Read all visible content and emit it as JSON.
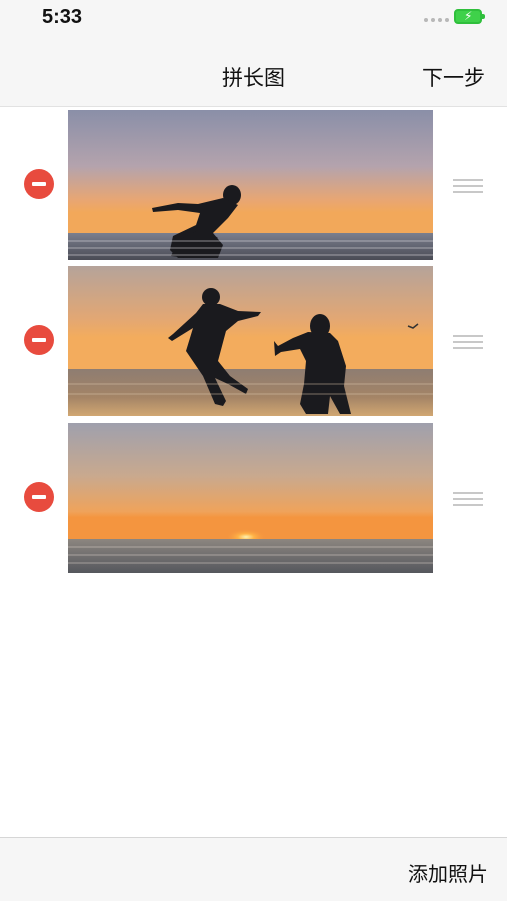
{
  "status_bar": {
    "time": "5:33",
    "battery_color": "#3fd14a"
  },
  "nav": {
    "title": "拼长图",
    "next_label": "下一步"
  },
  "photos": [
    {
      "scene": "silhouette-jumping-person-at-sunset"
    },
    {
      "scene": "silhouettes-man-and-child-playing-at-sunset"
    },
    {
      "scene": "sun-setting-over-sea"
    }
  ],
  "bottom": {
    "add_photo_label": "添加照片"
  },
  "colors": {
    "delete": "#e84b3e",
    "handle": "#c8c8c8"
  }
}
